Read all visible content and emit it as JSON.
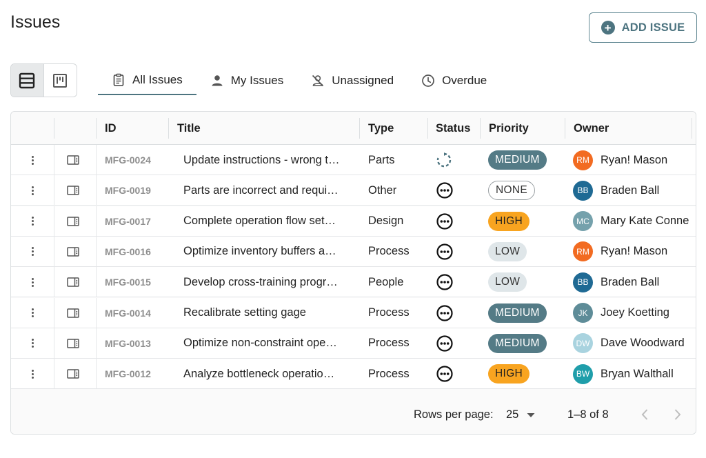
{
  "page": {
    "title": "Issues"
  },
  "actions": {
    "add_issue_label": "ADD ISSUE"
  },
  "tabs": [
    {
      "label": "All Issues",
      "icon": "clipboard-icon",
      "active": true
    },
    {
      "label": "My Issues",
      "icon": "person-icon",
      "active": false
    },
    {
      "label": "Unassigned",
      "icon": "person-off-icon",
      "active": false
    },
    {
      "label": "Overdue",
      "icon": "clock-icon",
      "active": false
    }
  ],
  "table": {
    "columns": [
      "ID",
      "Title",
      "Type",
      "Status",
      "Priority",
      "Owner"
    ],
    "rows": [
      {
        "id": "MFG-0024",
        "title": "Update instructions - wrong t…",
        "type": "Parts",
        "status": "in-progress",
        "priority": "MEDIUM",
        "owner": {
          "initials": "RM",
          "name": "Ryan! Mason",
          "color": "#f26b21"
        }
      },
      {
        "id": "MFG-0019",
        "title": "Parts are incorrect and requi…",
        "type": "Other",
        "status": "pending",
        "priority": "NONE",
        "owner": {
          "initials": "BB",
          "name": "Braden Ball",
          "color": "#1f6a94"
        }
      },
      {
        "id": "MFG-0017",
        "title": "Complete operation flow set…",
        "type": "Design",
        "status": "pending",
        "priority": "HIGH",
        "owner": {
          "initials": "MC",
          "name": "Mary Kate Conne",
          "color": "#75a1ac"
        }
      },
      {
        "id": "MFG-0016",
        "title": "Optimize inventory buffers a…",
        "type": "Process",
        "status": "pending",
        "priority": "LOW",
        "owner": {
          "initials": "RM",
          "name": "Ryan! Mason",
          "color": "#f26b21"
        }
      },
      {
        "id": "MFG-0015",
        "title": "Develop cross-training progr…",
        "type": "People",
        "status": "pending",
        "priority": "LOW",
        "owner": {
          "initials": "BB",
          "name": "Braden Ball",
          "color": "#1f6a94"
        }
      },
      {
        "id": "MFG-0014",
        "title": "Recalibrate setting gage",
        "type": "Process",
        "status": "pending",
        "priority": "MEDIUM",
        "owner": {
          "initials": "JK",
          "name": "Joey Koetting",
          "color": "#5e8c98"
        }
      },
      {
        "id": "MFG-0013",
        "title": "Optimize non-constraint ope…",
        "type": "Process",
        "status": "pending",
        "priority": "MEDIUM",
        "owner": {
          "initials": "DW",
          "name": "Dave Woodward",
          "color": "#a9d3df"
        }
      },
      {
        "id": "MFG-0012",
        "title": "Analyze bottleneck operatio…",
        "type": "Process",
        "status": "pending",
        "priority": "HIGH",
        "owner": {
          "initials": "BW",
          "name": "Bryan Walthall",
          "color": "#1f9eaa"
        }
      }
    ]
  },
  "pagination": {
    "rows_per_page_label": "Rows per page:",
    "rows_per_page": "25",
    "range": "1–8 of 8"
  },
  "colors": {
    "accent": "#4d7480",
    "high": "#f8a420",
    "medium": "#547b86",
    "low": "#dfe6e9"
  }
}
